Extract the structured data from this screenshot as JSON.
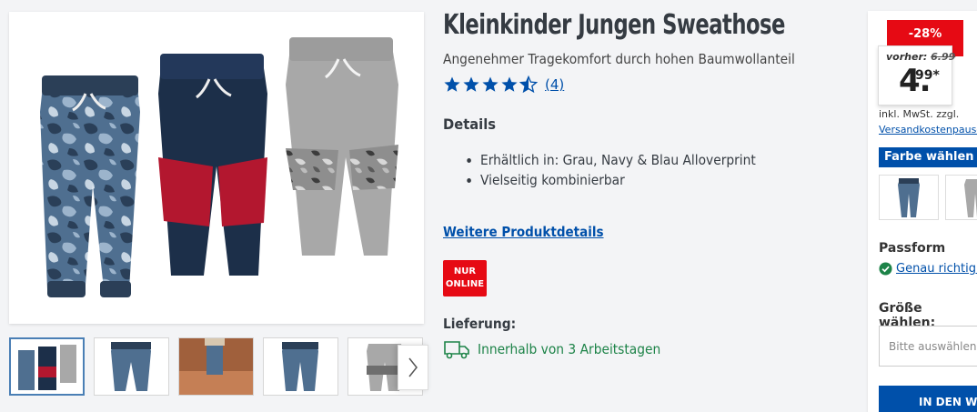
{
  "product": {
    "title": "Kleinkinder Jungen Sweathose",
    "subtitle": "Angenehmer Tragekomfort durch hohen Baumwollanteil",
    "rating": {
      "stars": 4.5,
      "max": 5,
      "reviews_label": "(4)"
    },
    "details_heading": "Details",
    "details": [
      "Erhältlich in: Grau, Navy & Blau Alloverprint",
      "Vielseitig kombinierbar"
    ],
    "more_details_link": "Weitere Produktdetails",
    "online_badge": {
      "line1": "NUR",
      "line2": "ONLINE"
    },
    "delivery_heading": "Lieferung:",
    "delivery_text": "Innerhalb von 3 Arbeitstagen"
  },
  "buybox": {
    "discount": "-28%",
    "old_price_prefix": "vorher:",
    "old_price": "6.99",
    "price_main": "4.",
    "price_cents": "99*",
    "vat_text": "inkl. MwSt. zzgl.",
    "shipping_link": "Versandkostenpauschale",
    "color_heading": "Farbe wählen",
    "fit_heading": "Passform",
    "fit_link": "Genau richtig (",
    "size_heading": "Größe wählen:",
    "size_placeholder": "Bitte auswählen...",
    "cart_button": "IN DEN WARENKORB"
  },
  "colors": {
    "accent": "#0050aa",
    "sale_red": "#e60a14",
    "success_green": "#1d8348",
    "star_blue": "#0050aa"
  },
  "icons": {
    "next": "chevron-right-icon",
    "delivery": "truck-icon",
    "fit": "check-circle-icon",
    "rating": "star-icon"
  }
}
